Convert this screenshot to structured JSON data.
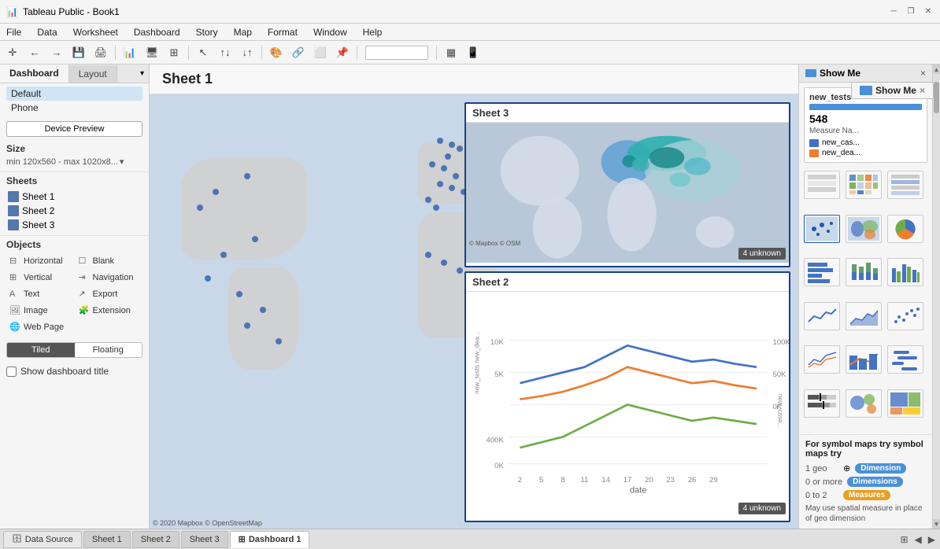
{
  "titlebar": {
    "title": "Tableau Public - Book1",
    "icon": "📊"
  },
  "menubar": {
    "items": [
      "File",
      "Data",
      "Worksheet",
      "Dashboard",
      "Story",
      "Map",
      "Format",
      "Window",
      "Help"
    ]
  },
  "showme": {
    "label": "Show Me",
    "close": "×"
  },
  "leftpanel": {
    "tab_dashboard": "Dashboard",
    "tab_layout": "Layout",
    "device_default": "Default",
    "device_phone": "Phone",
    "device_preview_btn": "Device Preview",
    "size_label": "Size",
    "size_value": "min 120x560 - max 1020x8...",
    "sheets_label": "Sheets",
    "sheet1": "Sheet 1",
    "sheet2": "Sheet 2",
    "sheet3": "Sheet 3",
    "objects_label": "Objects",
    "obj_horizontal": "Horizontal",
    "obj_blank": "Blank",
    "obj_vertical": "Vertical",
    "obj_navigation": "Navigation",
    "obj_text": "Text",
    "obj_export": "Export",
    "obj_image": "Image",
    "obj_extension": "Extension",
    "obj_webpage": "Web Page",
    "tiled_label": "Tiled",
    "floating_label": "Floating",
    "show_dashboard_title": "Show dashboard title"
  },
  "canvas": {
    "title": "Sheet 1",
    "attribution": "© 2020 Mapbox © OpenStreetMap",
    "sheet3_title": "Sheet 3",
    "sheet3_attr": "© Mapbox © OSM",
    "sheet3_unknown": "4 unknown",
    "sheet2_title": "Sheet 2",
    "sheet2_unknown": "4 unknown",
    "sheet2_date_label": "date"
  },
  "infocard": {
    "title": "new_tests",
    "value": "548",
    "measure_name_label": "Measure Na...",
    "legend1_label": "new_cas...",
    "legend2_label": "new_dea..."
  },
  "symbolmap": {
    "intro": "For symbol maps try",
    "row1_count": "1 geo",
    "row1_badge": "Dimension",
    "row2_count": "0 or more",
    "row2_badge": "Dimensions",
    "row3_count": "0 to 2",
    "row3_badge": "Measures",
    "spatial_note": "May use spatial measure in place of geo dimension"
  },
  "bottomtabs": {
    "datasource": "Data Source",
    "sheet1": "Sheet 1",
    "sheet2": "Sheet 2",
    "sheet3": "Sheet 3",
    "dashboard1": "Dashboard 1"
  }
}
